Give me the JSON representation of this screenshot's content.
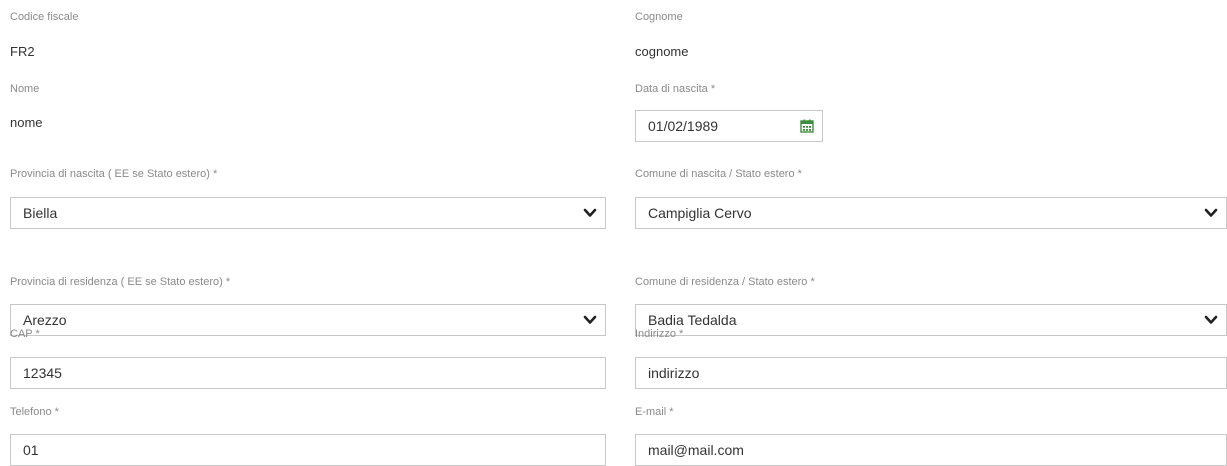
{
  "form": {
    "codice_fiscale": {
      "label": "Codice fiscale",
      "value": "FR2"
    },
    "cognome": {
      "label": "Cognome",
      "value": "cognome"
    },
    "nome": {
      "label": "Nome",
      "value": "nome"
    },
    "data_nascita": {
      "label": "Data di nascita *",
      "value": "01/02/1989",
      "icon": "calendar-icon"
    },
    "provincia_nascita": {
      "label": "Provincia di nascita ( EE se Stato estero) *",
      "value": "Biella",
      "icon": "chevron-down-icon"
    },
    "comune_nascita": {
      "label": "Comune di nascita / Stato estero *",
      "value": "Campiglia Cervo",
      "icon": "chevron-down-icon"
    },
    "provincia_residenza": {
      "label": "Provincia di residenza ( EE se Stato estero) *",
      "value": "Arezzo",
      "icon": "chevron-down-icon"
    },
    "comune_residenza": {
      "label": "Comune di residenza / Stato estero *",
      "value": "Badia Tedalda",
      "icon": "chevron-down-icon"
    },
    "cap": {
      "label": "CAP *",
      "value": "12345"
    },
    "indirizzo": {
      "label": "Indirizzo *",
      "value": "indirizzo"
    },
    "telefono": {
      "label": "Telefono *",
      "value": "01"
    },
    "email": {
      "label": "E-mail *",
      "value": "mail@mail.com"
    }
  },
  "colors": {
    "label": "#8a8a8a",
    "text": "#333333",
    "border": "#c8c8c8",
    "calendar_icon": "#3e8e3e"
  }
}
